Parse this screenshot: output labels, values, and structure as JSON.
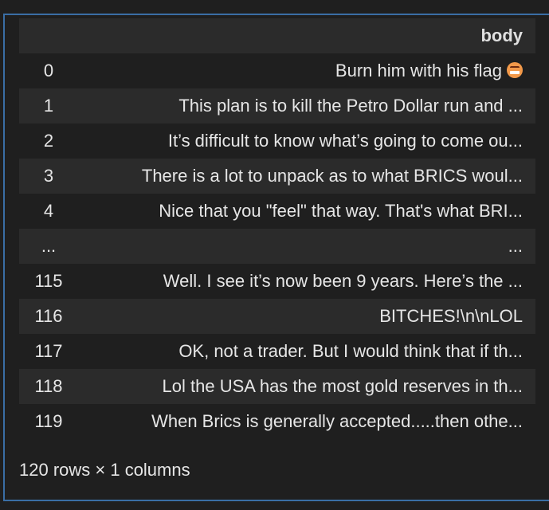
{
  "table": {
    "index_header": "",
    "column_header": "body",
    "rows": [
      {
        "index": "0",
        "value": "Burn him with his flag",
        "emoji": "angry-face-icon"
      },
      {
        "index": "1",
        "value": "This plan is to kill the Petro Dollar run and ..."
      },
      {
        "index": "2",
        "value": "It’s difficult to know what’s going to come ou..."
      },
      {
        "index": "3",
        "value": "There is a lot to unpack as to what BRICS woul..."
      },
      {
        "index": "4",
        "value": "Nice that you \"feel\" that way. That's what BRI..."
      },
      {
        "index": "...",
        "value": "..."
      },
      {
        "index": "115",
        "value": "Well. I see it’s now been 9 years. Here’s the ..."
      },
      {
        "index": "116",
        "value": "BITCHES!\\n\\nLOL"
      },
      {
        "index": "117",
        "value": "OK, not a trader. But I would think that if th..."
      },
      {
        "index": "118",
        "value": "Lol the USA has the most gold reserves in th..."
      },
      {
        "index": "119",
        "value": "When Brics is generally accepted.....then othe..."
      }
    ]
  },
  "summary": "120 rows × 1 columns",
  "colors": {
    "background": "#1f1f1f",
    "stripe": "#2b2b2b",
    "focus_border": "#3a6ea5",
    "text": "#e6e6e6"
  }
}
